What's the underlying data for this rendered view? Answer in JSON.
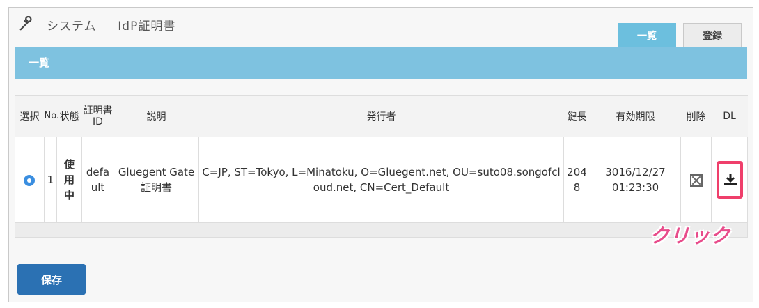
{
  "header": {
    "title": "システム ｜ IdP証明書",
    "tabs": [
      {
        "label": "一覧",
        "active": true
      },
      {
        "label": "登録",
        "active": false
      }
    ]
  },
  "banner": {
    "label": "一覧"
  },
  "table": {
    "columns": [
      "選択",
      "No.",
      "状態",
      "証明書ID",
      "説明",
      "発行者",
      "鍵長",
      "有効期限",
      "削除",
      "DL"
    ],
    "rows": [
      {
        "selected": true,
        "no": "1",
        "status": "使用中",
        "cert_id": "default",
        "description": "Gluegent Gate 証明書",
        "issuer": "C=JP, ST=Tokyo, L=Minatoku, O=Gluegent.net, OU=suto08.songofcloud.net, CN=Cert_Default",
        "key_length": "2048",
        "expiry": "3016/12/27 01:23:30"
      }
    ]
  },
  "annotation": "クリック",
  "save_label": "保存",
  "colors": {
    "accent": "#2b71b3",
    "banner": "#7ec2e0",
    "highlight": "#ef3f6b"
  }
}
